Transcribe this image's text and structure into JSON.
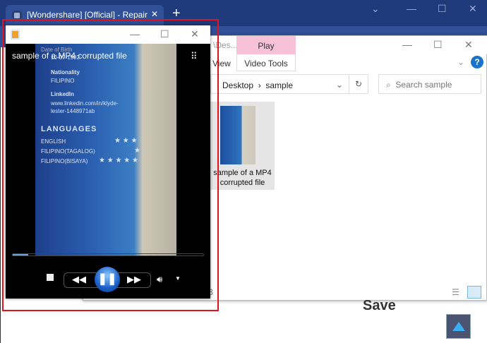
{
  "browser": {
    "tab_title": "[Wondershare] [Official] - Repair",
    "tab_close": "✕",
    "new_tab": "+",
    "controls": [
      "⌄",
      "—",
      "☐",
      "✕"
    ]
  },
  "explorer": {
    "title_fragment": "\\Des...",
    "play_tab": "Play",
    "view_tab": "View",
    "video_tools_tab": "Video Tools",
    "help": "?",
    "path": [
      "Desktop",
      "sample"
    ],
    "search_placeholder": "Search sample",
    "file_name": "sample of a MP4 corrupted file",
    "status_fragment": "B",
    "controls": [
      "—",
      "☐",
      "✕"
    ]
  },
  "player": {
    "title": "sample of a MP4 corrupted file",
    "progress_percent": 8,
    "controls": [
      "—",
      "☐",
      "✕"
    ],
    "video_text": {
      "dob_label": "Date of Birth",
      "dob": "10-07-1992",
      "nationality_label": "Nationality",
      "nationality": "FILIPINO",
      "linkedin_label": "LinkedIn",
      "linkedin_1": "www.linkedin.com/in/klyde-",
      "linkedin_2": "lester-1448971ab",
      "languages": "LANGUAGES",
      "lang": [
        {
          "name": "ENGLISH",
          "stars": "★ ★ ★"
        },
        {
          "name": "FILIPINO(TAGALOG)",
          "stars": "★"
        },
        {
          "name": "FILIPINO(BISAYA)",
          "stars": "★ ★ ★ ★ ★"
        }
      ]
    }
  },
  "page": {
    "save_heading": "Save"
  }
}
